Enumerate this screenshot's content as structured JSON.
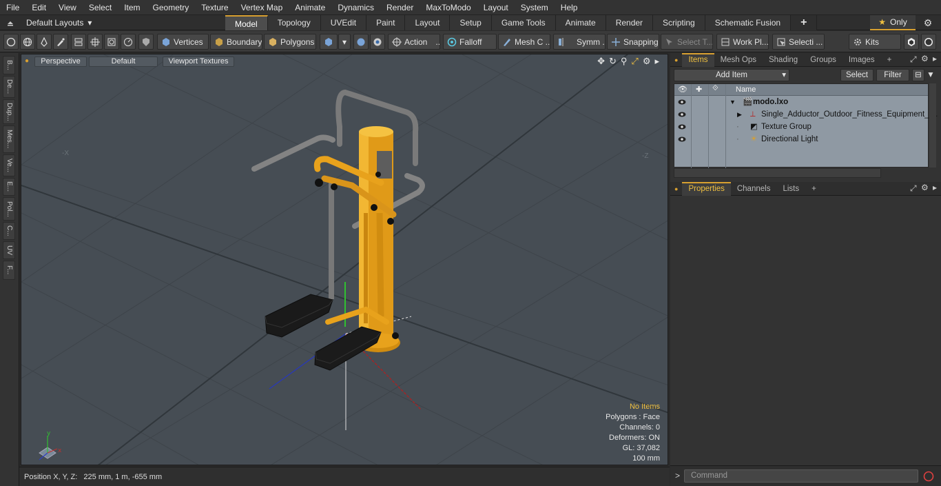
{
  "menu": [
    "File",
    "Edit",
    "View",
    "Select",
    "Item",
    "Geometry",
    "Texture",
    "Vertex Map",
    "Animate",
    "Dynamics",
    "Render",
    "MaxToModo",
    "Layout",
    "System",
    "Help"
  ],
  "layout": {
    "label": "Default Layouts"
  },
  "tabs": [
    "Model",
    "Topology",
    "UVEdit",
    "Paint",
    "Layout",
    "Setup",
    "Game Tools",
    "Animate",
    "Render",
    "Scripting",
    "Schematic Fusion"
  ],
  "tab_plus": "+",
  "only": {
    "label": "Only"
  },
  "toolbar": {
    "vertices": "Vertices",
    "boundary": "Boundary",
    "polygons": "Polygons",
    "action": "Action",
    "action_more": "...",
    "falloff": "Falloff",
    "mesh_c": "Mesh C ...",
    "symm": "Symm ...",
    "snapping": "Snapping",
    "select_t": "Select T...",
    "work_pl": "Work Pl...",
    "selecti": "Selecti ...",
    "kits": "Kits"
  },
  "left_tabs": [
    "B...",
    "De...",
    "Dup...",
    "Mes...",
    "Ve...",
    "E...",
    "Pol...",
    "C...",
    "UV",
    "F..."
  ],
  "viewport": {
    "view": "Perspective",
    "shading": "Default",
    "textures": "Viewport Textures",
    "label_x": "-X",
    "label_z": "-Z",
    "stats": {
      "items": "No Items",
      "polygons": "Polygons : Face",
      "channels": "Channels: 0",
      "deformers": "Deformers: ON",
      "gl": "GL: 37,082",
      "unit": "100 mm"
    }
  },
  "status": {
    "position": "Position X, Y, Z:   225 mm, 1 m, -655 mm"
  },
  "items_panel": {
    "tabs": [
      "Items",
      "Mesh Ops",
      "Shading",
      "Groups",
      "Images"
    ],
    "add_item": "Add Item",
    "select": "Select",
    "filter": "Filter",
    "column_name": "Name",
    "rows": [
      {
        "label": "modo.lxo",
        "bold": true
      },
      {
        "label": "Single_Adductor_Outdoor_Fitness_Equipment_ ..."
      },
      {
        "label": "Texture Group"
      },
      {
        "label": "Directional Light"
      }
    ]
  },
  "properties_panel": {
    "tabs": [
      "Properties",
      "Channels",
      "Lists"
    ]
  },
  "command": {
    "placeholder": "Command",
    "prompt": ">"
  },
  "colors": {
    "accent": "#d8a030",
    "model_yellow": "#e8a21c",
    "pipe_grey": "#8a8a8a",
    "pedal": "#1a1a1a",
    "viewport_bg": "#464d54",
    "list_bg": "#8f99a3"
  }
}
